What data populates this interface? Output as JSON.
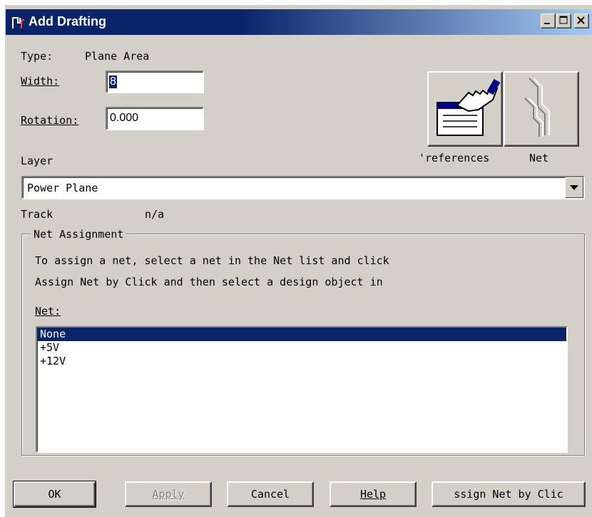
{
  "window": {
    "title": "Add Drafting"
  },
  "fields": {
    "type_label": "Type:",
    "type_value": "Plane Area",
    "width_label": "Width:",
    "width_value": "8",
    "rotation_label": "Rotation:",
    "rotation_value": "0.000"
  },
  "toolbar": {
    "preferences_label": "'references",
    "net_label": "Net"
  },
  "layer": {
    "label": "Layer",
    "selected": "Power Plane"
  },
  "track": {
    "label": "Track",
    "value": "n/a"
  },
  "net_assignment": {
    "group_label": "Net Assignment",
    "instructions_line1": "To assign a net, select a net in the Net list and click",
    "instructions_line2": "Assign Net by Click and then select a design object in",
    "net_label": "Net:",
    "items": [
      "None",
      "+5V",
      "+12V"
    ],
    "selected_index": 0
  },
  "buttons": {
    "ok": "OK",
    "apply": "Apply",
    "cancel": "Cancel",
    "help": "Help",
    "assign": "ssign Net by Clic"
  },
  "colors": {
    "titlebar": "#0a246a",
    "face": "#d4d0c8",
    "selection": "#0a246a"
  }
}
